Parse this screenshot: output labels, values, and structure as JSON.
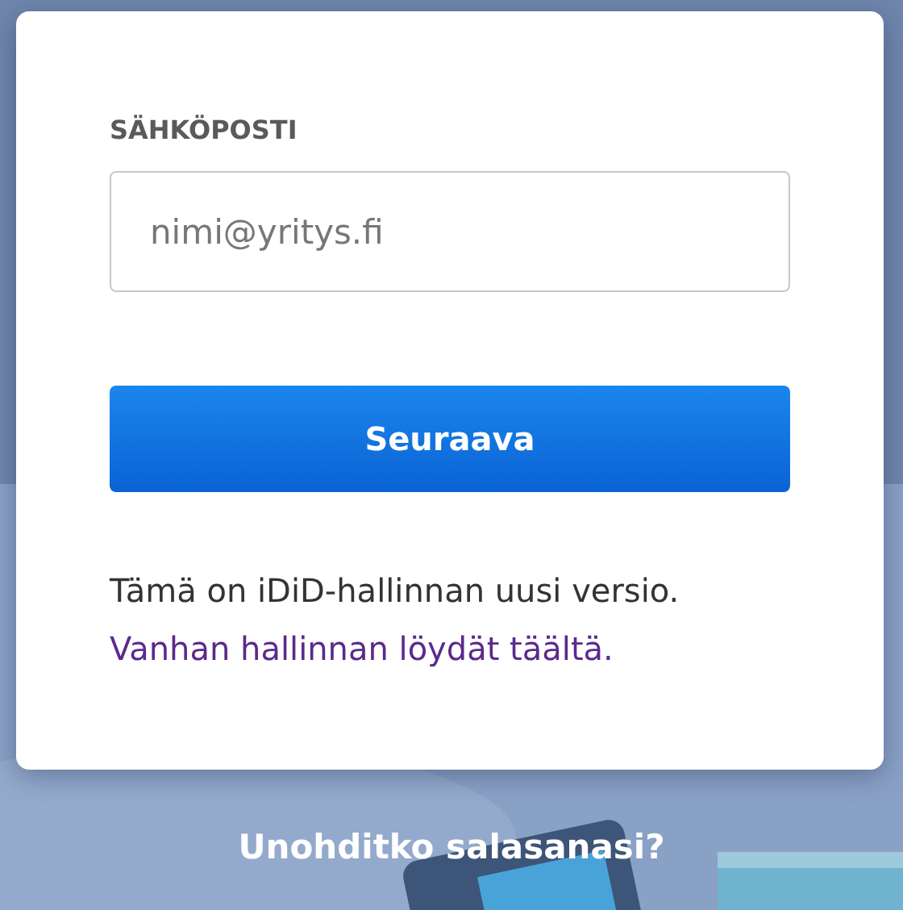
{
  "login": {
    "email_label": "SÄHKÖPOSTI",
    "email_field": {
      "placeholder": "nimi@yritys.fi"
    },
    "next_button": "Seuraava",
    "info_text": "Tämä on iDiD-hallinnan uusi versio.",
    "old_admin_link": "Vanhan hallinnan löydät täältä."
  },
  "forgot_password_link": "Unohditko salasanasi?"
}
